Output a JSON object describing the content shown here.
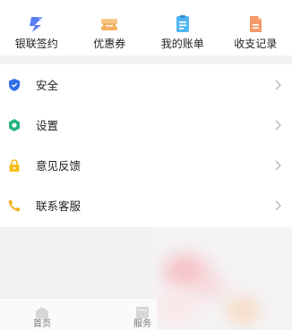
{
  "quick_actions": [
    {
      "label": "银联签约",
      "icon": "unionpay-sign-icon"
    },
    {
      "label": "优惠券",
      "icon": "coupon-icon"
    },
    {
      "label": "我的账单",
      "icon": "bill-icon"
    },
    {
      "label": "收支记录",
      "icon": "records-icon"
    }
  ],
  "menu": [
    {
      "label": "安全",
      "icon": "shield-icon"
    },
    {
      "label": "设置",
      "icon": "settings-icon"
    },
    {
      "label": "意见反馈",
      "icon": "lock-icon"
    },
    {
      "label": "联系客服",
      "icon": "phone-icon"
    }
  ],
  "bottom_nav": [
    {
      "label": "首页",
      "icon": "home-icon"
    },
    {
      "label": "服务",
      "icon": "service-icon"
    }
  ],
  "colors": {
    "unionpay_blue": "#5b7cf0",
    "coupon_orange": "#f2b15e",
    "bill_blue": "#52b6f2",
    "records_orange": "#f59a6a",
    "shield_blue": "#2f6fe8",
    "settings_green": "#25b37e",
    "lock_yellow": "#f6be1c",
    "phone_yellow": "#f3b21a"
  }
}
